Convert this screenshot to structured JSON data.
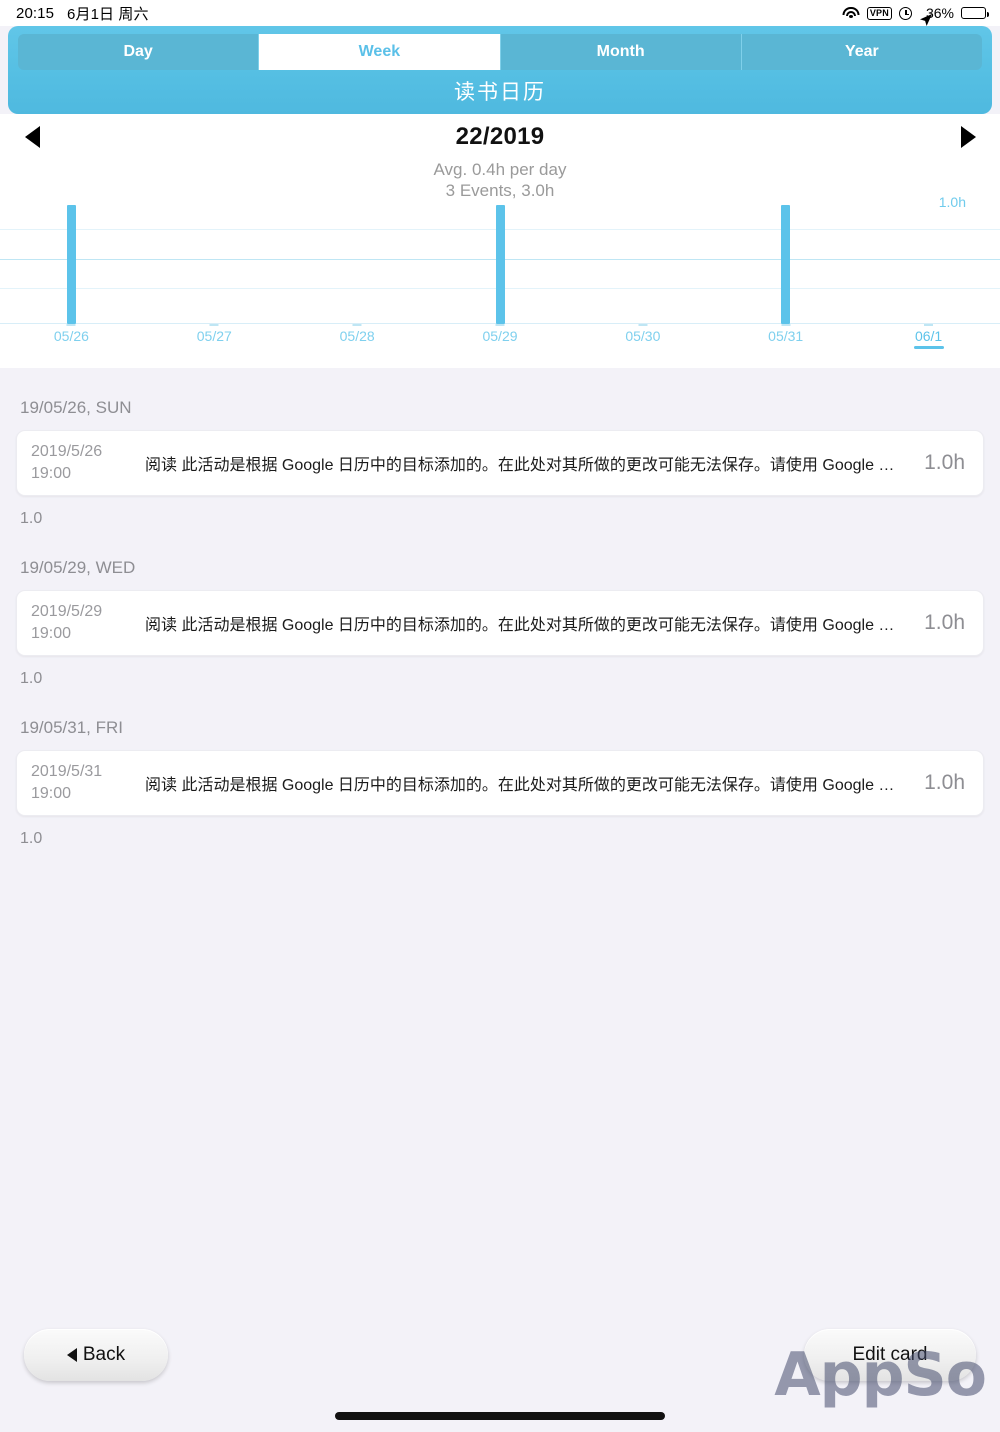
{
  "status_bar": {
    "time": "20:15",
    "date": "6月1日 周六",
    "battery_percent": "36%",
    "icons": [
      "wifi-icon",
      "vpn-icon",
      "alarm-icon",
      "location-arrow-icon",
      "battery-icon"
    ],
    "vpn_label": "VPN"
  },
  "header": {
    "title": "读书日历",
    "tabs": [
      {
        "label": "Day",
        "active": false
      },
      {
        "label": "Week",
        "active": true
      },
      {
        "label": "Month",
        "active": false
      },
      {
        "label": "Year",
        "active": false
      }
    ]
  },
  "navigation": {
    "prev_icon": "triangle-left-icon",
    "next_icon": "triangle-right-icon",
    "period_label": "22/2019",
    "summary_line_1": "Avg. 0.4h per day",
    "summary_line_2": "3 Events, 3.0h"
  },
  "chart_data": {
    "type": "bar",
    "title": "22/2019",
    "categories": [
      "05/26",
      "05/27",
      "05/28",
      "05/29",
      "05/30",
      "05/31",
      "06/1"
    ],
    "values": [
      1.0,
      0,
      0,
      1.0,
      0,
      1.0,
      0
    ],
    "value_label": "1.0h",
    "ylabel": "",
    "xlabel": "",
    "ylim": [
      0,
      1.0
    ],
    "grid": true,
    "gridlines": [
      0.25,
      0.5,
      0.75,
      1.0
    ],
    "today_category": "06/1",
    "bar_color": "#5cc3ea",
    "grid_color": "#e3f3fa",
    "axis_label_color": "#7fd0ee"
  },
  "colors": {
    "accent": "#5cc3ea",
    "header_gradient_top": "#61c6e8",
    "list_background": "#f3f2f8",
    "muted_text": "#8e8e93"
  },
  "event_groups": [
    {
      "day_header": "19/05/26, SUN",
      "total": "1.0",
      "events": [
        {
          "date": "2019/5/26",
          "time": "19:00",
          "title": "阅读 此活动是根据 Google 日历中的目标添加的。在此处对其所做的更改可能无法保存。请使用 Google 日…",
          "duration": "1.0h"
        }
      ]
    },
    {
      "day_header": "19/05/29, WED",
      "total": "1.0",
      "events": [
        {
          "date": "2019/5/29",
          "time": "19:00",
          "title": "阅读 此活动是根据 Google 日历中的目标添加的。在此处对其所做的更改可能无法保存。请使用 Google 日…",
          "duration": "1.0h"
        }
      ]
    },
    {
      "day_header": "19/05/31, FRI",
      "total": "1.0",
      "events": [
        {
          "date": "2019/5/31",
          "time": "19:00",
          "title": "阅读 此活动是根据 Google 日历中的目标添加的。在此处对其所做的更改可能无法保存。请使用 Google 日…",
          "duration": "1.0h"
        }
      ]
    }
  ],
  "footer": {
    "back_label": "Back",
    "edit_label": "Edit card",
    "watermark": "AppSo"
  }
}
